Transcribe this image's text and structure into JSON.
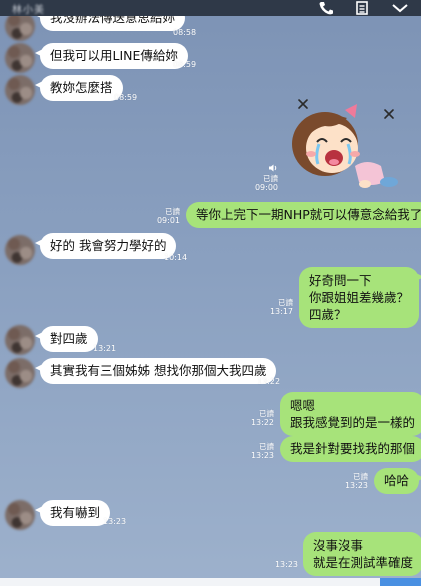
{
  "header": {
    "title": "林小美",
    "call_icon": "phone-icon",
    "notes_icon": "notes-icon",
    "menu_icon": "chevron-down-icon"
  },
  "messages": [
    {
      "side": "in",
      "text": "我沒辦法傳送意思給妳",
      "time": "08:58"
    },
    {
      "side": "in",
      "text": "但我可以用LINE傳給妳",
      "time": "08:59"
    },
    {
      "side": "in",
      "text": "教妳怎麼搭",
      "time": "08:59"
    },
    {
      "side": "out",
      "type": "sticker",
      "read": "已讀",
      "time": "09:00",
      "sticker": "crying-girl-sticker",
      "sound_icon": "speaker-icon"
    },
    {
      "side": "out",
      "text": "等你上完下一期NHP就可以傳意念給我了",
      "read": "已讀",
      "time": "09:01"
    },
    {
      "side": "in",
      "text": "好的 我會努力學好的",
      "time": "10:14"
    },
    {
      "side": "out",
      "lines": [
        "好奇問一下",
        "你跟姐姐差幾歲？",
        "四歲？"
      ],
      "read": "已讀",
      "time": "13:17"
    },
    {
      "side": "in",
      "text": "對四歲",
      "time": "13:21"
    },
    {
      "side": "in",
      "text": "其實我有三個姊姊 想找你那個大我四歲",
      "time": "13:22"
    },
    {
      "side": "out",
      "lines": [
        "嗯嗯",
        "跟我感覺到的是一樣的"
      ],
      "read": "已讀",
      "time": "13:22"
    },
    {
      "side": "out",
      "text": "我是針對要找我的那個",
      "read": "已讀",
      "time": "13:23"
    },
    {
      "side": "out",
      "text": "哈哈",
      "read": "已讀",
      "time": "13:23"
    },
    {
      "side": "in",
      "text": "我有嚇到",
      "time": "13:23"
    },
    {
      "side": "out",
      "lines": [
        "沒事沒事",
        "就是在測試準確度"
      ],
      "time": "13:23"
    }
  ],
  "colors": {
    "background": "#8aa0c0",
    "incoming_bubble": "#ffffff",
    "outgoing_bubble": "#a7e37a",
    "header": "#2f3948"
  }
}
